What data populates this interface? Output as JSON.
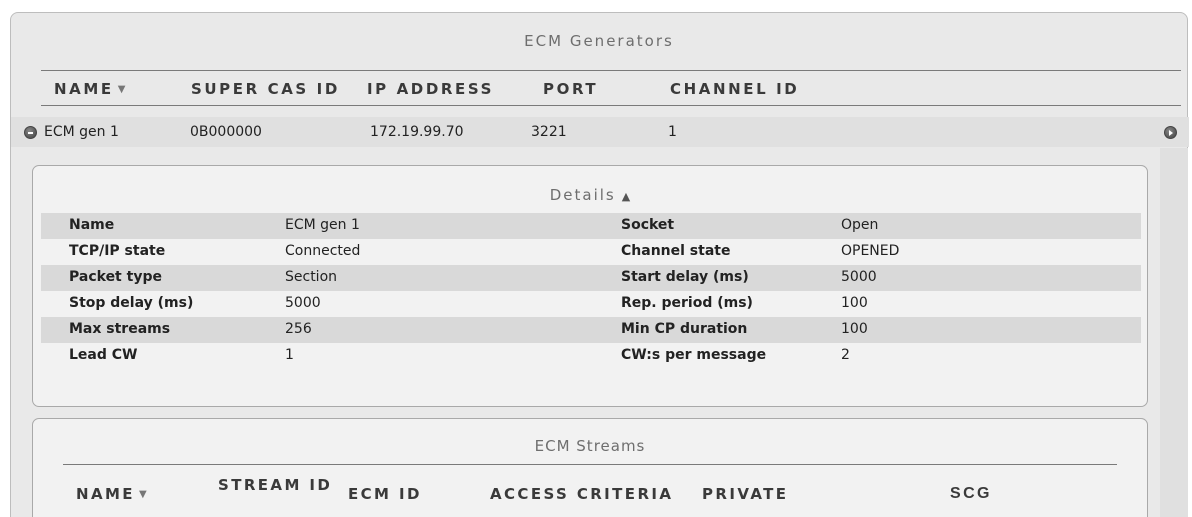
{
  "generators_panel": {
    "title": "ECM Generators",
    "columns": [
      "NAME",
      "SUPER CAS ID",
      "IP ADDRESS",
      "PORT",
      "CHANNEL ID"
    ],
    "row": {
      "name": "ECM gen 1",
      "super_cas_id": "0B000000",
      "ip_address": "172.19.99.70",
      "port": "3221",
      "channel_id": "1"
    }
  },
  "details": {
    "title": "Details",
    "fields": [
      {
        "label": "Name",
        "value": "ECM gen 1",
        "label2": "Socket",
        "value2": "Open"
      },
      {
        "label": "TCP/IP state",
        "value": "Connected",
        "label2": "Channel state",
        "value2": "OPENED"
      },
      {
        "label": "Packet type",
        "value": "Section",
        "label2": "Start delay (ms)",
        "value2": "5000"
      },
      {
        "label": "Stop delay (ms)",
        "value": "5000",
        "label2": "Rep. period (ms)",
        "value2": "100"
      },
      {
        "label": "Max streams",
        "value": "256",
        "label2": "Min CP duration",
        "value2": "100"
      },
      {
        "label": "Lead CW",
        "value": "1",
        "label2": "CW:s per message",
        "value2": "2"
      }
    ]
  },
  "streams_panel": {
    "title": "ECM Streams",
    "columns": {
      "name": "NAME",
      "stream_id": "STREAM ID",
      "ecm_id": "ECM ID",
      "access_criteria": "ACCESS CRITERIA",
      "private": "PRIVATE",
      "scg": "SCG"
    }
  },
  "icons": {
    "sort": "sort-down-caret",
    "collapse": "collapse-minus-icon",
    "expand": "expand-arrow-icon",
    "details_toggle": "chevron-up-icon"
  }
}
